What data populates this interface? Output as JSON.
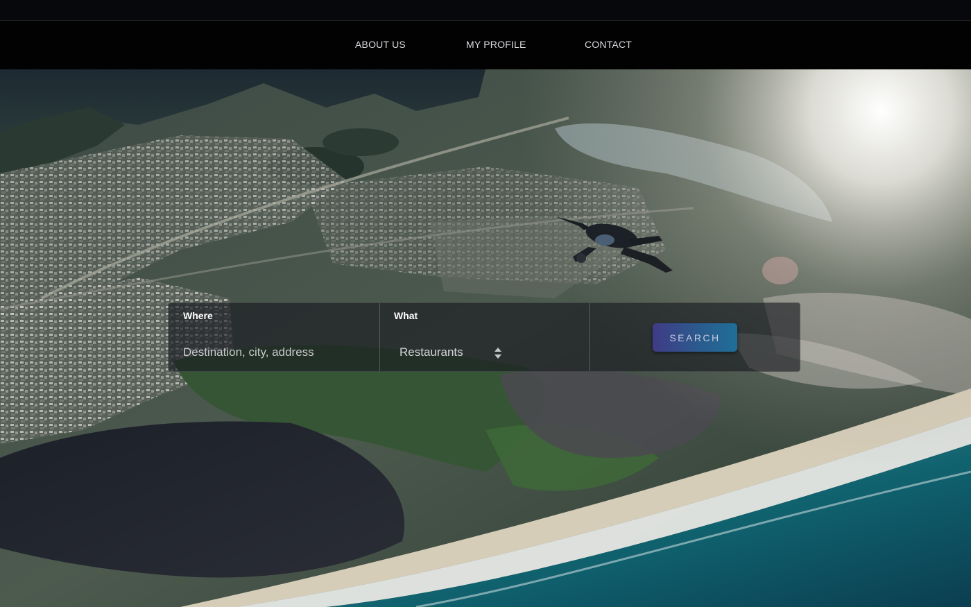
{
  "nav": {
    "items": [
      {
        "label": "ABOUT US"
      },
      {
        "label": "MY PROFILE"
      },
      {
        "label": "CONTACT"
      }
    ]
  },
  "hero": {
    "image": "aerial-skydiver-photo"
  },
  "search": {
    "where": {
      "label": "Where",
      "placeholder": "Destination, city, address",
      "value": ""
    },
    "what": {
      "label": "What",
      "selected": "Restaurants"
    },
    "button_label": "SEARCH"
  },
  "colors": {
    "nav_background": "#020203",
    "button_gradient_start": "#3f3b86",
    "button_gradient_end": "#1f6f98"
  }
}
